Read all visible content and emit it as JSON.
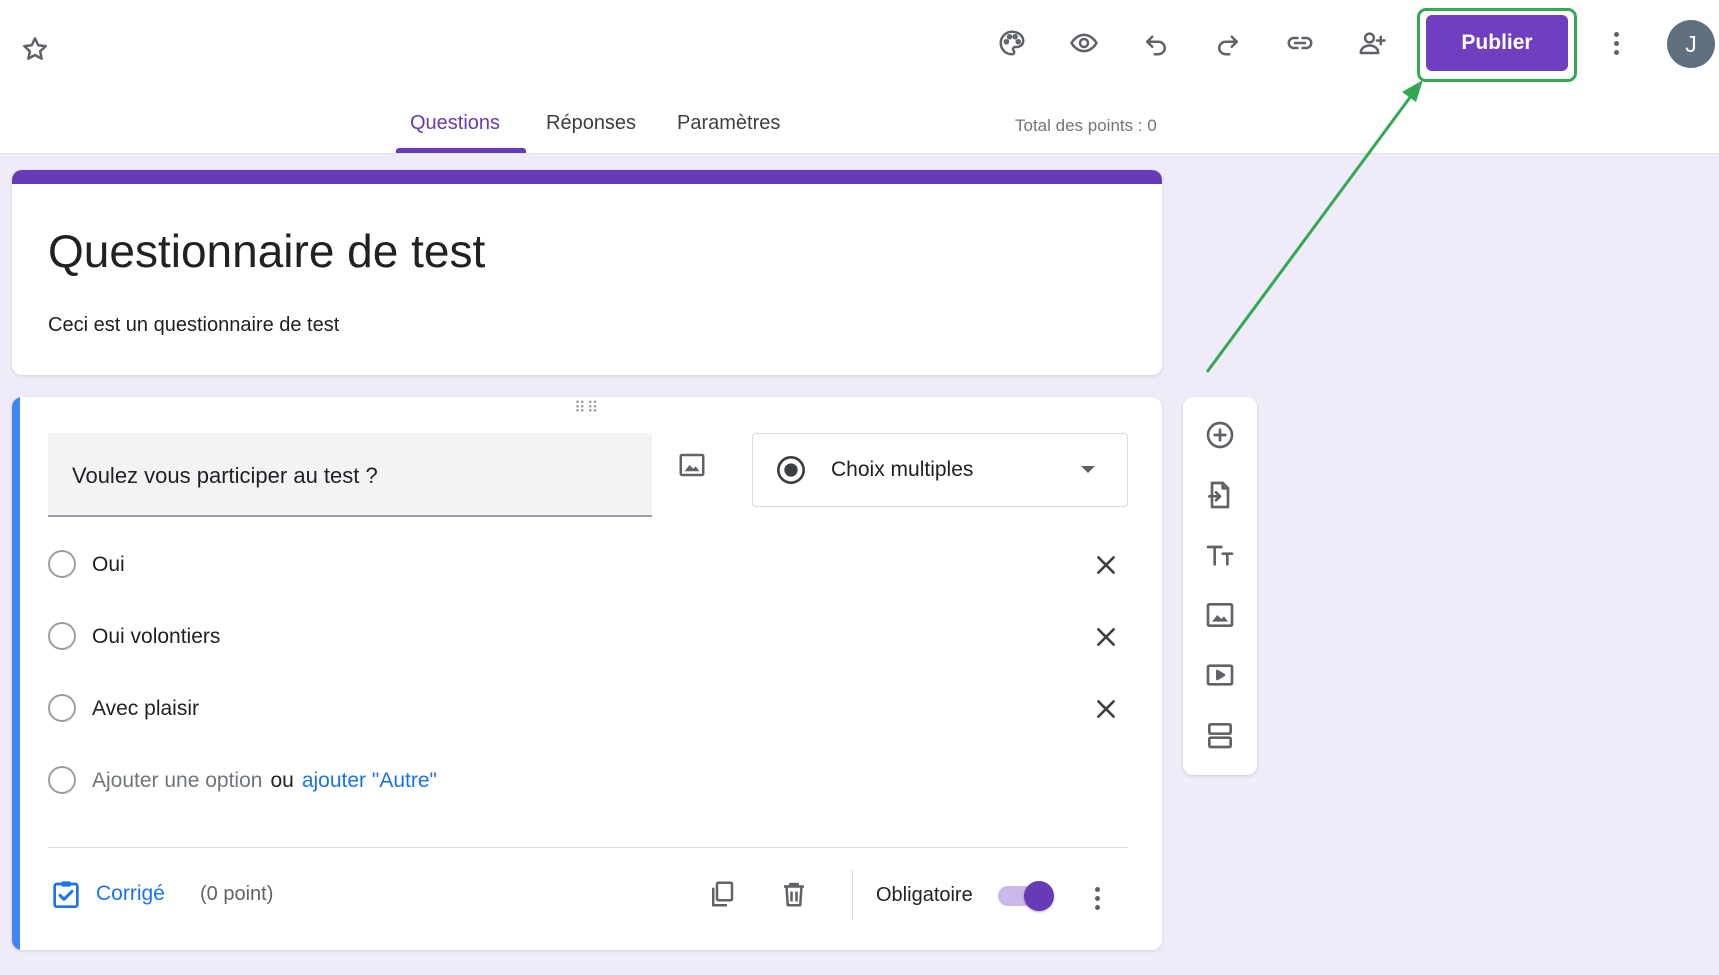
{
  "header": {
    "publish_label": "Publier",
    "avatar_initial": "J",
    "icons": [
      "star-icon",
      "palette-icon",
      "eye-icon",
      "undo-icon",
      "redo-icon",
      "link-icon",
      "add-person-icon",
      "more-vert-icon"
    ]
  },
  "tabs": {
    "questions": "Questions",
    "responses": "Réponses",
    "settings": "Paramètres",
    "active": "Questions"
  },
  "total_points": "Total des points : 0",
  "form": {
    "title": "Questionnaire de test",
    "description": "Ceci est un questionnaire de test"
  },
  "question": {
    "text": "Voulez vous participer au test ?",
    "type_label": "Choix multiples",
    "options": [
      "Oui",
      "Oui volontiers",
      "Avec plaisir"
    ],
    "add_option": "Ajouter une option",
    "or": "ou",
    "add_other": "ajouter \"Autre\"",
    "answer_key_label": "Corrigé",
    "points": "(0 point)",
    "required_label": "Obligatoire",
    "required": true
  },
  "side_toolbar": [
    "add-question-icon",
    "import-questions-icon",
    "add-title-icon",
    "add-image-icon",
    "add-video-icon",
    "add-section-icon"
  ],
  "colors": {
    "brand": "#673ab7",
    "publish_button": "#6f3fc0",
    "highlight": "#34a853",
    "question_accent": "#4285f4",
    "link": "#1a73e8"
  }
}
